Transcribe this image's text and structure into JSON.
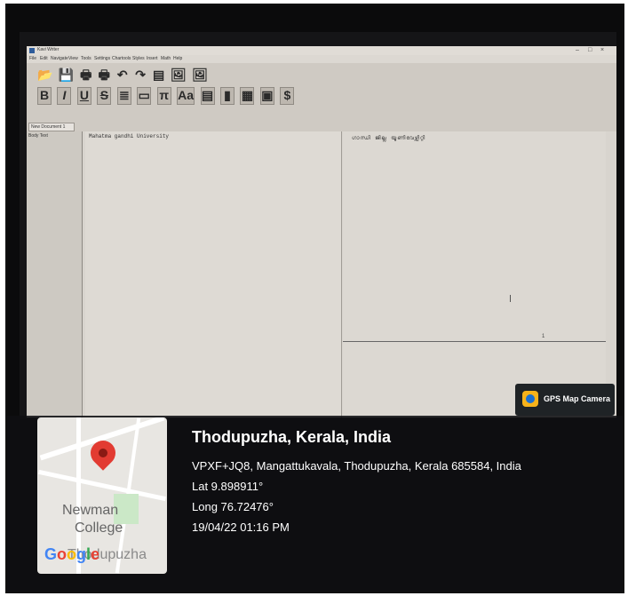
{
  "window": {
    "title": "Kavi Writer",
    "controls": [
      "–",
      "□",
      "×"
    ],
    "menus": [
      "File",
      "Edit",
      "Navigate",
      "View",
      "Tools",
      "Settings",
      "Chartools",
      "Styles",
      "Insert",
      "Math",
      "Help"
    ]
  },
  "toolbar": {
    "row1": [
      "📂",
      "💾",
      "🖶",
      "🖶",
      "↶",
      "↷",
      "▤",
      "🖼",
      "🖼"
    ],
    "row2": [
      "B",
      "I",
      "U",
      "S",
      "≣",
      "▭",
      "π",
      "Aa",
      "▤",
      "▮",
      "▦",
      "▣",
      "$"
    ]
  },
  "document": {
    "tab_label": "New Document 1",
    "style_value": "Body Text",
    "text": "Mahatma gandhi University",
    "preview_text": "ഗാന്ധി ജില്ല യൂണിവേഴ്സിറ്റി",
    "page_mark": "1"
  },
  "gps_badge": {
    "label": "GPS Map Camera"
  },
  "location": {
    "place": "Thodupuzha, Kerala, India",
    "address": "VPXF+JQ8, Mangattukavala, Thodupuzha, Kerala 685584, India",
    "latitude": "Lat 9.898911°",
    "longitude": "Long 76.72476°",
    "datetime": "19/04/22 01:16 PM"
  },
  "map": {
    "label_line1": "Newman",
    "label_line2": "College",
    "label_line3": "Thodupuzha",
    "brand": [
      "G",
      "o",
      "o",
      "g",
      "l",
      "e"
    ]
  }
}
